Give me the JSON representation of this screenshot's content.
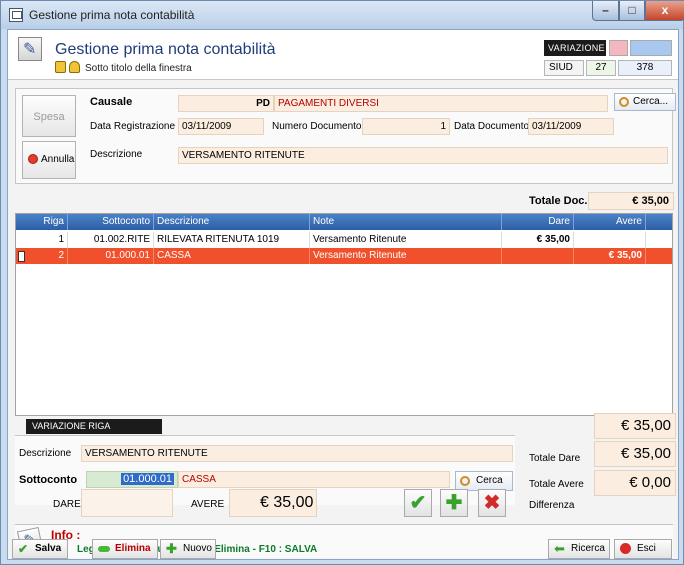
{
  "window": {
    "title": "Gestione prima nota contabilità",
    "minimize": "–",
    "maximize": "□",
    "close": "x"
  },
  "header": {
    "title": "Gestione prima nota contabilità",
    "subtitle": "Sotto titolo della finestra",
    "variazione_label": "VARIAZIONE",
    "siud_label": "SIUD",
    "siud_number": "27",
    "siud_value": "378"
  },
  "form": {
    "spesa_button": "Spesa",
    "annulla_button": "Annulla",
    "causale_label": "Causale",
    "causale_code": "PD",
    "causale_desc": "PAGAMENTI DIVERSI",
    "cerca_button": "Cerca...",
    "data_registrazione_label": "Data Registrazione",
    "data_registrazione": "03/11/2009",
    "numero_documento_label": "Numero Documento",
    "numero_documento": "1",
    "data_documento_label": "Data Documento",
    "data_documento": "03/11/2009",
    "descrizione_label": "Descrizione",
    "descrizione": "VERSAMENTO RITENUTE",
    "totale_doc_label": "Totale Doc.",
    "totale_doc": "€ 35,00"
  },
  "grid": {
    "columns": [
      "Riga",
      "Sottoconto",
      "Descrizione",
      "Note",
      "Dare",
      "Avere"
    ],
    "rows": [
      {
        "riga": "1",
        "sottoconto": "01.002.RITE",
        "descrizione": "RILEVATA RITENUTA 1019",
        "note": "Versamento Ritenute",
        "dare": "€ 35,00",
        "avere": ""
      },
      {
        "riga": "2",
        "sottoconto": "01.000.01",
        "descrizione": "CASSA",
        "note": "Versamento Ritenute",
        "dare": "",
        "avere": "€ 35,00"
      }
    ]
  },
  "riga": {
    "section_label": "VARIAZIONE RIGA",
    "descrizione_label": "Descrizione",
    "descrizione": "VERSAMENTO RITENUTE",
    "sottoconto_label": "Sottoconto",
    "sottoconto_code": "01.000.01",
    "sottoconto_desc": "CASSA",
    "cerca_button": "Cerca",
    "dare_label": "DARE",
    "dare": "",
    "avere_label": "AVERE",
    "avere": "€ 35,00"
  },
  "totals": {
    "totale_dare_label": "Totale Dare",
    "totale_dare": "€ 35,00",
    "totale_avere_label": "Totale Avere",
    "totale_avere": "€ 35,00",
    "differenza_label": "Differenza",
    "differenza": "€ 0,00"
  },
  "info": {
    "title": "Info :",
    "legend": "Legenda : Ins : Nuova - Del : Elimina - F10 : SALVA"
  },
  "toolbar": {
    "salva": "Salva",
    "elimina": "Elimina",
    "nuovo": "Nuovo",
    "ricerca": "Ricerca",
    "esci": "Esci"
  },
  "colors": {
    "selected_row": "#f0512c",
    "grid_header": "#2c5ea5",
    "field_bg": "#fbeee0"
  }
}
